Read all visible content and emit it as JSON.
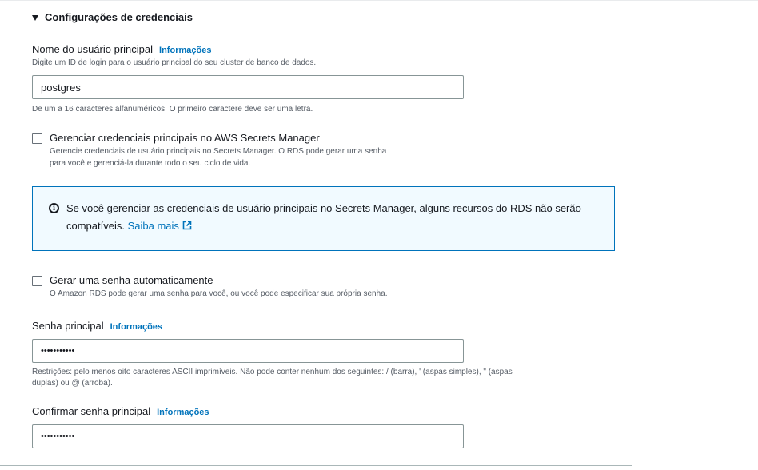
{
  "section": {
    "title": "Configurações de credenciais"
  },
  "username": {
    "label": "Nome do usuário principal",
    "info": "Informações",
    "description": "Digite um ID de login para o usuário principal do seu cluster de banco de dados.",
    "value": "postgres",
    "constraint": "De um a 16 caracteres alfanuméricos. O primeiro caractere deve ser uma letra."
  },
  "secrets_manager": {
    "label": "Gerenciar credenciais principais no AWS Secrets Manager",
    "description_line1": "Gerencie credenciais de usuário principais no Secrets Manager. O RDS pode gerar uma senha",
    "description_line2": "para você e gerenciá-la durante todo o seu ciclo de vida.",
    "checked": false
  },
  "alert": {
    "icon": "info-circle-icon",
    "text": "Se você gerenciar as credenciais de usuário principais no Secrets Manager, alguns recursos do RDS não serão compatíveis.",
    "link": "Saiba mais",
    "link_icon": "external-link-icon"
  },
  "auto_password": {
    "label": "Gerar uma senha automaticamente",
    "description": "O Amazon RDS pode gerar uma senha para você, ou você pode especificar sua própria senha.",
    "checked": false
  },
  "master_password": {
    "label": "Senha principal",
    "info": "Informações",
    "value": "•••••••••••",
    "constraint_line1": "Restrições: pelo menos oito caracteres ASCII imprimíveis. Não pode conter nenhum dos seguintes: / (barra), ' (aspas simples), \" (aspas",
    "constraint_line2": "duplas) ou @ (arroba)."
  },
  "confirm_password": {
    "label": "Confirmar senha principal",
    "info": "Informações",
    "value": "•••••••••••"
  },
  "colors": {
    "link": "#0073bb",
    "alert_border": "#0073bb",
    "alert_bg": "#f1faff",
    "text": "#16191f",
    "muted": "#545b64"
  }
}
